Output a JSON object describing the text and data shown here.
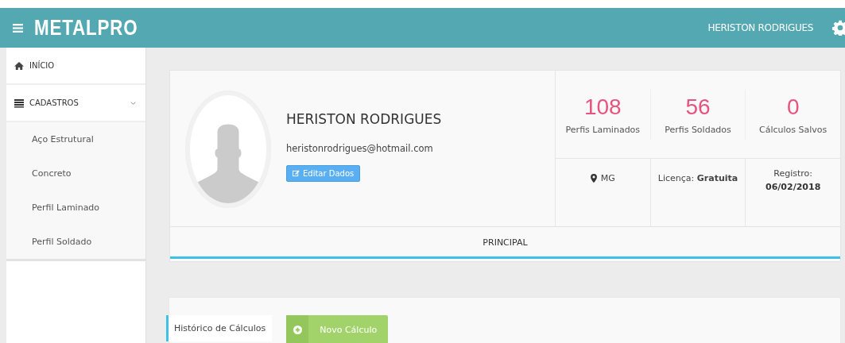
{
  "header": {
    "brand": "METALPRO",
    "user": "HERISTON RODRIGUES"
  },
  "sidebar": {
    "items": [
      {
        "label": "INÍCIO",
        "kind": "home"
      },
      {
        "label": "CADASTROS",
        "kind": "list",
        "expanded": true,
        "children": [
          {
            "label": "Aço Estrutural"
          },
          {
            "label": "Concreto"
          },
          {
            "label": "Perfil Laminado"
          },
          {
            "label": "Perfil Soldado"
          }
        ]
      }
    ]
  },
  "profile": {
    "name": "HERISTON RODRIGUES",
    "email": "heristonrodrigues@hotmail.com",
    "edit_button": "Editar Dados",
    "stats": [
      {
        "value": "108",
        "label": "Perfis Laminados"
      },
      {
        "value": "56",
        "label": "Perfis Soldados"
      },
      {
        "value": "0",
        "label": "Cálculos Salvos"
      }
    ],
    "details": [
      {
        "kind": "location",
        "text": "MG"
      },
      {
        "kind": "text",
        "text": "Licença: **Gratuita**"
      },
      {
        "kind": "lines",
        "text": "Registro:",
        "value": "06/02/2018"
      }
    ],
    "tabs": [
      {
        "label": "PRINCIPAL",
        "selected": true
      }
    ]
  },
  "history": {
    "tabs": [
      {
        "label": "Histórico de Cálculos",
        "selected": true
      }
    ],
    "new_button": "Novo Cálculo"
  }
}
